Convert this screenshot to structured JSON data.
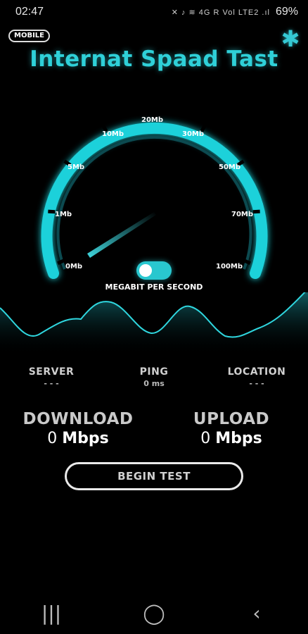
{
  "status_bar": {
    "time": "02:47",
    "icons": "✕ ♪ ≋ 4G R Vol LTE2 .ıl",
    "battery": "69%"
  },
  "mode_badge": "MOBILE",
  "app_title": "Internat Spaad Tast",
  "gauge": {
    "labels": [
      "0Mb",
      "1Mb",
      "5Mb",
      "10Mb",
      "20Mb",
      "30Mb",
      "50Mb",
      "70Mb",
      "100Mb"
    ],
    "current_speed_mb": 0,
    "accent_color": "#1fd1da",
    "unit_caption": "MEGABIT PER SECOND",
    "toggle_on": true
  },
  "stats": {
    "server": {
      "label": "SERVER",
      "value": "- - -"
    },
    "ping": {
      "label": "PING",
      "value": "0 ms"
    },
    "location": {
      "label": "LOCATION",
      "value": "- - -"
    }
  },
  "download": {
    "label": "DOWNLOAD",
    "value": "0",
    "unit": "Mbps"
  },
  "upload": {
    "label": "UPLOAD",
    "value": "0",
    "unit": "Mbps"
  },
  "begin_button": "BEGIN TEST",
  "nav": {
    "recents_icon": "|||",
    "home_icon": "◯",
    "back_icon": "‹"
  }
}
